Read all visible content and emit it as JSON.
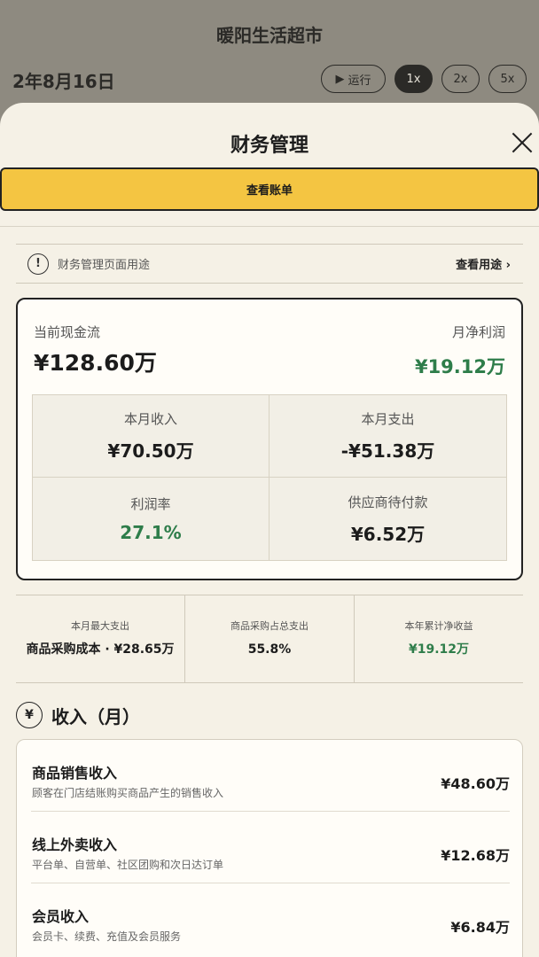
{
  "app": {
    "store_name": "暖阳生活超市",
    "date": "2年8月16日",
    "run_label": "运行",
    "speeds": [
      "1x",
      "2x",
      "5x"
    ],
    "active_speed": "1x"
  },
  "sheet": {
    "title": "财务管理",
    "view_bill_label": "查看账单",
    "purpose_label": "财务管理页面用途",
    "purpose_link": "查看用途 ›"
  },
  "cashflow": {
    "current_label": "当前现金流",
    "current_value": "¥128.60万",
    "net_profit_label": "月净利润",
    "net_profit_value": "¥19.12万",
    "cells": [
      {
        "label": "本月收入",
        "value": "¥70.50万"
      },
      {
        "label": "本月支出",
        "value": "-¥51.38万"
      },
      {
        "label": "利润率",
        "value": "27.1%"
      },
      {
        "label": "供应商待付款",
        "value": "¥6.52万"
      }
    ]
  },
  "stats": [
    {
      "label": "本月最大支出",
      "value": "商品采购成本 · ¥28.65万"
    },
    {
      "label": "商品采购占总支出",
      "value": "55.8%"
    },
    {
      "label": "本年累计净收益",
      "value": "¥19.12万"
    }
  ],
  "income": {
    "icon_glyph": "¥",
    "title": "收入（月）",
    "items": [
      {
        "name": "商品销售收入",
        "desc": "顾客在门店结账购买商品产生的销售收入",
        "amount": "¥48.60万"
      },
      {
        "name": "线上外卖收入",
        "desc": "平台单、自营单、社区团购和次日达订单",
        "amount": "¥12.68万"
      },
      {
        "name": "会员收入",
        "desc": "会员卡、续费、充值及会员服务",
        "amount": "¥6.84万"
      }
    ]
  },
  "colors": {
    "accent_yellow": "#f4c542",
    "positive_green": "#2e7d4a",
    "sheet_bg": "#f5f1e6"
  }
}
